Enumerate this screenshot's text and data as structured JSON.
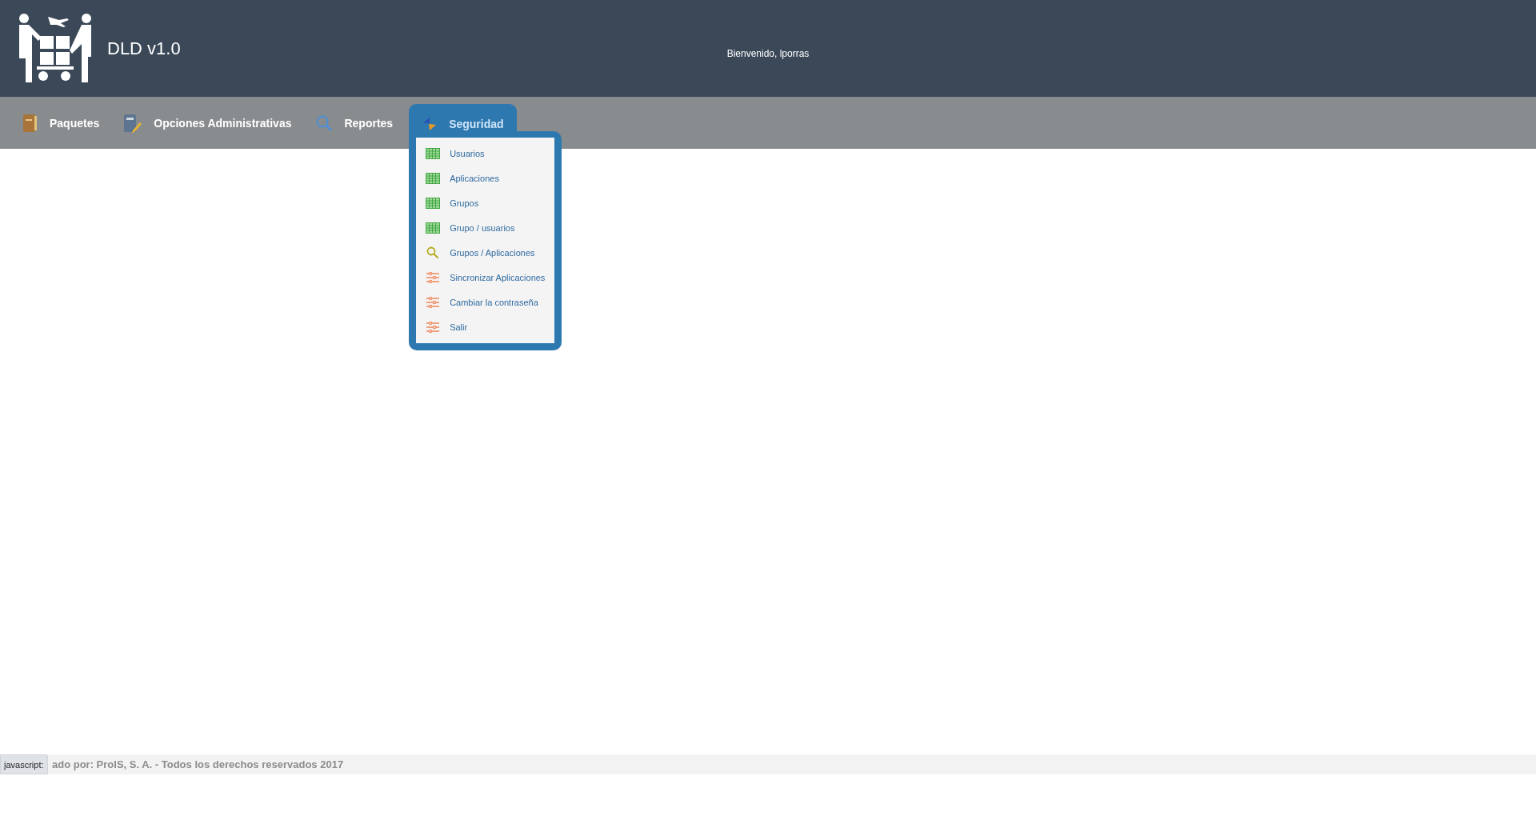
{
  "header": {
    "title": "DLD v1.0",
    "welcome": "Bienvenido, lporras"
  },
  "nav": [
    {
      "label": "Paquetes",
      "kind": "book",
      "selected": false
    },
    {
      "label": "Opciones Administrativas",
      "kind": "binder",
      "selected": false
    },
    {
      "label": "Reportes",
      "kind": "search",
      "selected": false
    },
    {
      "label": "Seguridad",
      "kind": "arrows",
      "selected": true,
      "menu": [
        {
          "label": "Usuarios",
          "kind": "table"
        },
        {
          "label": "Aplicaciones",
          "kind": "table"
        },
        {
          "label": "Grupos",
          "kind": "table"
        },
        {
          "label": "Grupo / usuarios",
          "kind": "table"
        },
        {
          "label": "Grupos / Aplicaciones",
          "kind": "search"
        },
        {
          "label": "Sincronizar Aplicaciones",
          "kind": "sliders"
        },
        {
          "label": "Cambiar la contraseña",
          "kind": "sliders"
        },
        {
          "label": "Salir",
          "kind": "sliders"
        }
      ]
    }
  ],
  "footer": {
    "text": "ado por: ProIS, S. A. - Todos los derechos reservados 2017"
  },
  "status_tooltip": "javascript:"
}
